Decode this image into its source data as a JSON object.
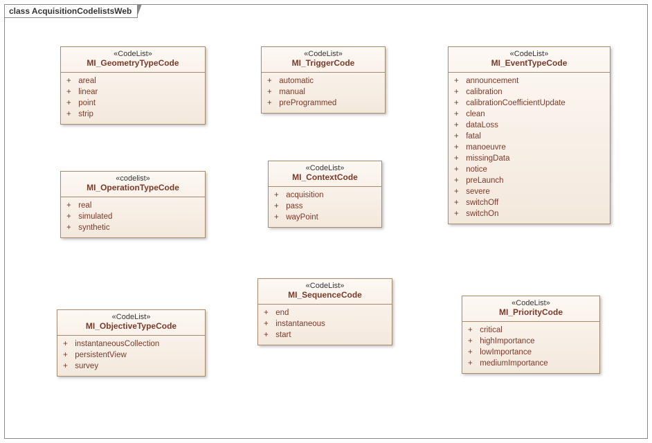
{
  "frame": {
    "title": "class AcquisitionCodelistsWeb"
  },
  "boxes": {
    "geometry": {
      "stereo": "«CodeList»",
      "name": "MI_GeometryTypeCode",
      "items": [
        "areal",
        "linear",
        "point",
        "strip"
      ]
    },
    "trigger": {
      "stereo": "«CodeList»",
      "name": "MI_TriggerCode",
      "items": [
        "automatic",
        "manual",
        "preProgrammed"
      ]
    },
    "event": {
      "stereo": "«CodeList»",
      "name": "MI_EventTypeCode",
      "items": [
        "announcement",
        "calibration",
        "calibrationCoefficientUpdate",
        "clean",
        "dataLoss",
        "fatal",
        "manoeuvre",
        "missingData",
        "notice",
        "preLaunch",
        "severe",
        "switchOff",
        "switchOn"
      ]
    },
    "operation": {
      "stereo": "«codelist»",
      "name": "MI_OperationTypeCode",
      "items": [
        "real",
        "simulated",
        "synthetic"
      ]
    },
    "context": {
      "stereo": "«CodeList»",
      "name": "MI_ContextCode",
      "items": [
        "acquisition",
        "pass",
        "wayPoint"
      ]
    },
    "sequence": {
      "stereo": "«CodeList»",
      "name": "MI_SequenceCode",
      "items": [
        "end",
        "instantaneous",
        "start"
      ]
    },
    "objective": {
      "stereo": "«CodeList»",
      "name": "MI_ObjectiveTypeCode",
      "items": [
        "instantaneousCollection",
        "persistentView",
        "survey"
      ]
    },
    "priority": {
      "stereo": "«CodeList»",
      "name": "MI_PriorityCode",
      "items": [
        "critical",
        "highImportance",
        "lowImportance",
        "mediumImportance"
      ]
    }
  }
}
